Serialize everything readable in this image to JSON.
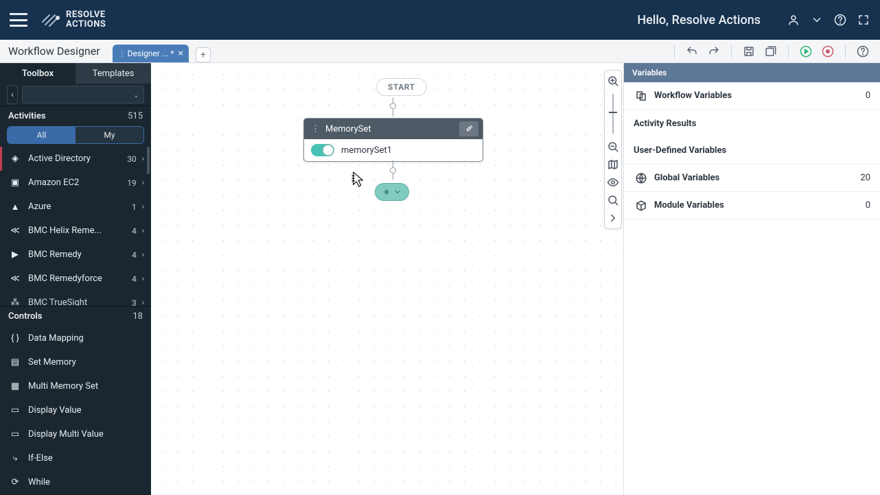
{
  "header": {
    "brand_top": "RESOLVE",
    "brand_bottom": "ACTIONS",
    "greeting": "Hello, Resolve Actions"
  },
  "secbar": {
    "title": "Workflow Designer",
    "tab_label": "Designer ... *"
  },
  "sidebar": {
    "tabs": {
      "toolbox": "Toolbox",
      "templates": "Templates"
    },
    "activities_label": "Activities",
    "activities_count": "515",
    "filter_all": "All",
    "filter_my": "My",
    "activities": [
      {
        "label": "Active Directory",
        "count": "30"
      },
      {
        "label": "Amazon EC2",
        "count": "19"
      },
      {
        "label": "Azure",
        "count": "1"
      },
      {
        "label": "BMC Helix Reme...",
        "count": "4"
      },
      {
        "label": "BMC Remedy",
        "count": "4"
      },
      {
        "label": "BMC Remedyforce",
        "count": "4"
      },
      {
        "label": "BMC TrueSight",
        "count": "3"
      }
    ],
    "controls_label": "Controls",
    "controls_count": "18",
    "controls": [
      "Data Mapping",
      "Set Memory",
      "Multi Memory Set",
      "Display Value",
      "Display Multi Value",
      "If-Else",
      "While"
    ]
  },
  "canvas": {
    "start": "START",
    "node_title": "MemorySet",
    "node_value": "memorySet1"
  },
  "vars": {
    "heading": "Variables",
    "workflow": "Workflow Variables",
    "workflow_cnt": "0",
    "activity": "Activity Results",
    "userdef": "User-Defined Variables",
    "global": "Global Variables",
    "global_cnt": "20",
    "module": "Module Variables",
    "module_cnt": "0"
  }
}
